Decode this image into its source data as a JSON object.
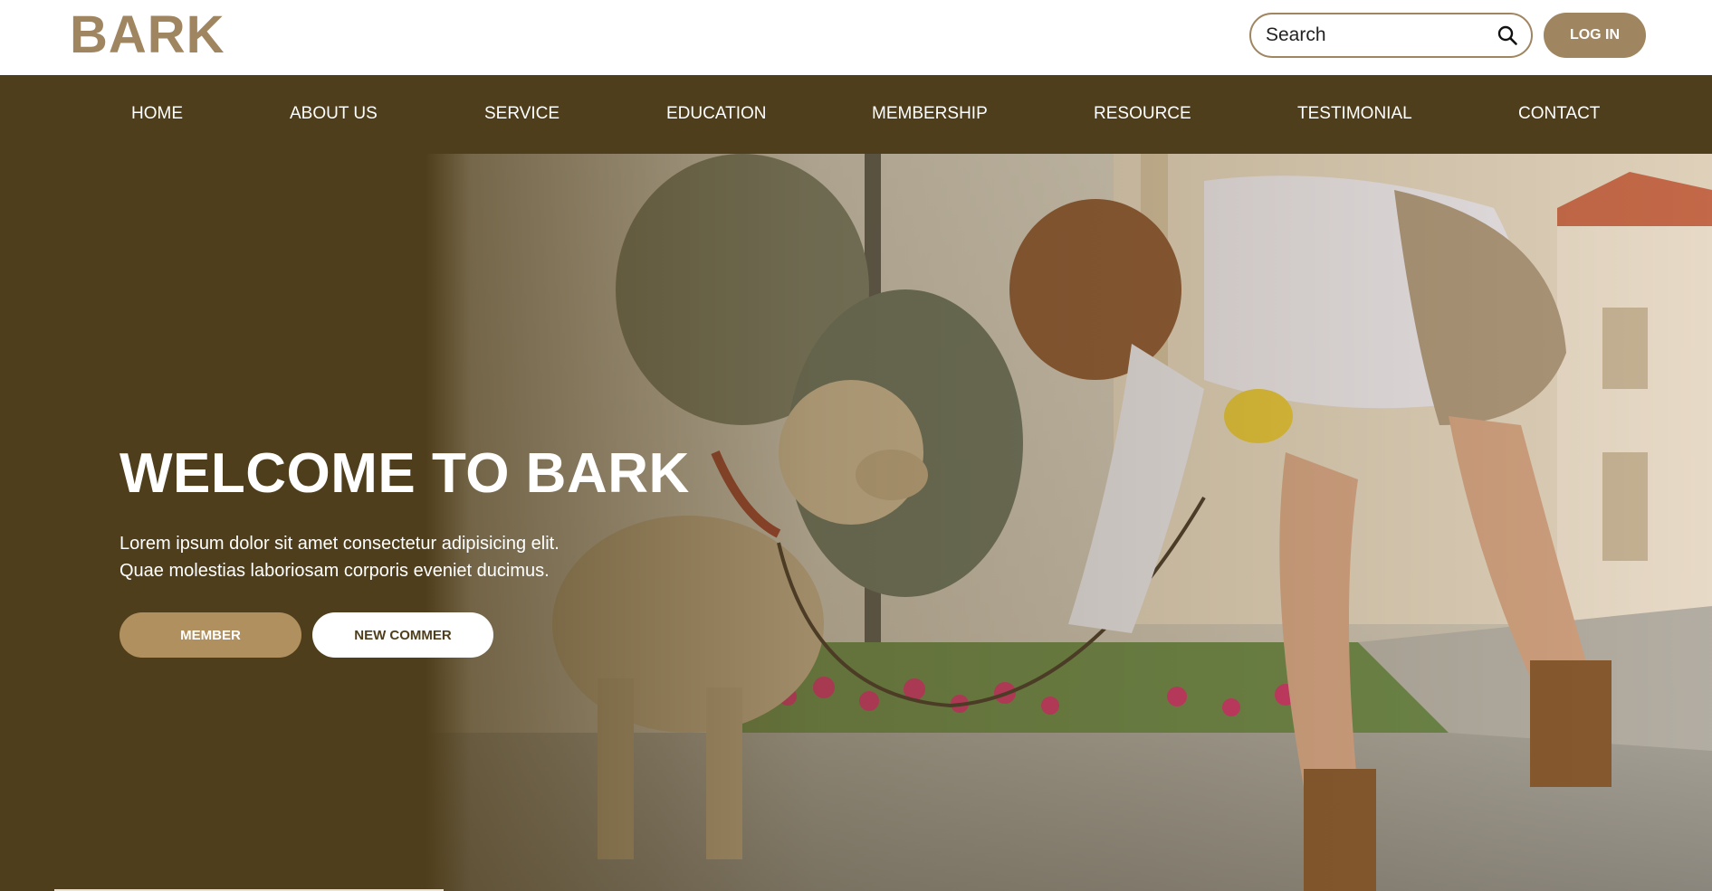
{
  "header": {
    "logo": "BARK",
    "search": {
      "placeholder": "Search",
      "icon": "search-icon"
    },
    "login_label": "LOG IN"
  },
  "nav": {
    "items": [
      {
        "label": "HOME"
      },
      {
        "label": "ABOUT US"
      },
      {
        "label": "SERVICE"
      },
      {
        "label": "EDUCATION"
      },
      {
        "label": "MEMBERSHIP"
      },
      {
        "label": "RESOURCE"
      },
      {
        "label": "TESTIMONIAL"
      },
      {
        "label": "CONTACT"
      }
    ]
  },
  "hero": {
    "title": "WELCOME TO BARK",
    "text_line1": "Lorem ipsum dolor sit amet consectetur adipisicing elit.",
    "text_line2": "Quae molestias laboriosam corporis eveniet ducimus.",
    "member_label": "MEMBER",
    "newcomer_label": "NEW COMMER"
  },
  "colors": {
    "brand": "#a08561",
    "nav_bg": "#4f3e1b",
    "member_btn": "#b0905f",
    "white": "#ffffff"
  }
}
